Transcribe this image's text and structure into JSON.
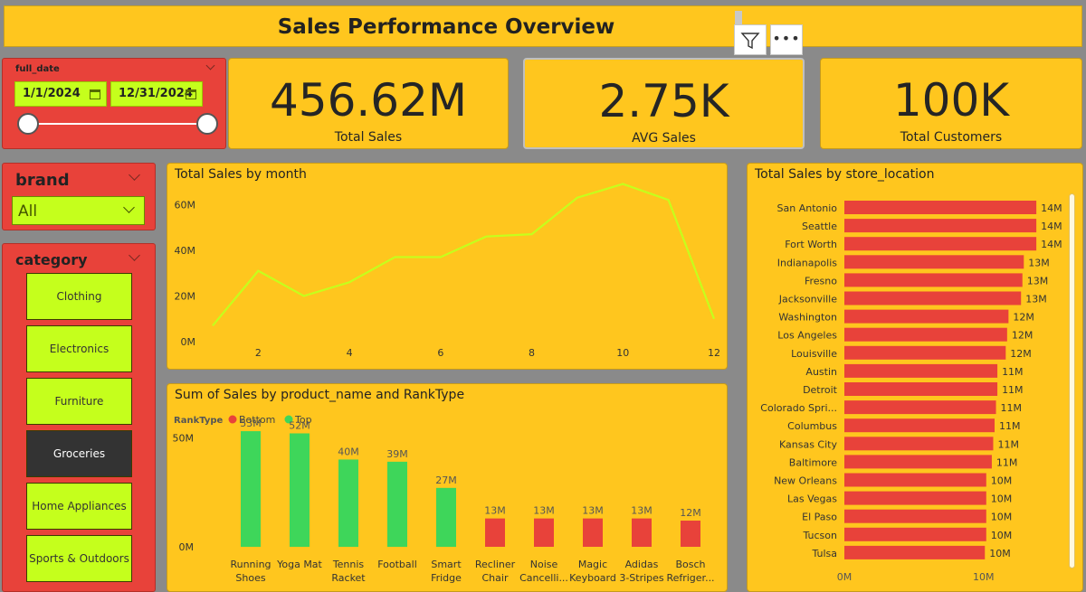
{
  "header": {
    "title": "Sales Performance Overview"
  },
  "date_slicer": {
    "label": "full_date",
    "start": "1/1/2024",
    "end": "12/31/2024"
  },
  "kpis": [
    {
      "value": "456.62M",
      "label": "Total Sales"
    },
    {
      "value": "2.75K",
      "label": "AVG Sales"
    },
    {
      "value": "100K",
      "label": "Total Customers"
    }
  ],
  "brand_slicer": {
    "label": "brand",
    "value": "All"
  },
  "category_slicer": {
    "label": "category",
    "items": [
      "Clothing",
      "Electronics",
      "Furniture",
      "Groceries",
      "Home Appliances",
      "Sports & Outdoors"
    ],
    "selected": "Groceries"
  },
  "colors": {
    "background": "#8a8a8a",
    "panel": "#ffc61e",
    "slicer": "#e8423a",
    "accent_lime": "#c5ff1c",
    "top_green": "#3ed65a",
    "bottom_red": "#e8423a",
    "line": "#c5ff1c"
  },
  "icons": {
    "filter": "filter-icon",
    "more": "more-options-icon",
    "calendar": "calendar-icon"
  },
  "chart_data": [
    {
      "type": "line",
      "title": "Total Sales by month",
      "x": [
        1,
        2,
        3,
        4,
        5,
        6,
        7,
        8,
        9,
        10,
        11,
        12
      ],
      "x_ticks": [
        "2",
        "4",
        "6",
        "8",
        "10",
        "12"
      ],
      "y_ticks": [
        "0M",
        "20M",
        "40M",
        "60M"
      ],
      "series": [
        {
          "values": [
            7,
            31,
            20,
            26,
            37,
            37,
            46,
            47,
            63,
            69,
            62,
            10
          ]
        }
      ],
      "ylim": [
        0,
        70
      ],
      "xlim": [
        1,
        12
      ],
      "grid": false
    },
    {
      "type": "bar",
      "title": "Sum of Sales by product_name and RankType",
      "legend_title": "RankType",
      "legend": [
        "Bottom",
        "Top"
      ],
      "categories": [
        "Running Shoes",
        "Yoga Mat",
        "Tennis Racket",
        "Football",
        "Smart Fridge",
        "Recliner Chair",
        "Noise Cancelli...",
        "Magic Keyboard",
        "Adidas 3-Stripes",
        "Bosch Refriger..."
      ],
      "category_lines": [
        [
          "Running",
          "Shoes"
        ],
        [
          "Yoga Mat"
        ],
        [
          "Tennis",
          "Racket"
        ],
        [
          "Football"
        ],
        [
          "Smart",
          "Fridge"
        ],
        [
          "Recliner",
          "Chair"
        ],
        [
          "Noise",
          "Cancelli..."
        ],
        [
          "Magic",
          "Keyboard"
        ],
        [
          "Adidas",
          "3-Stripes"
        ],
        [
          "Bosch",
          "Refriger..."
        ]
      ],
      "values": [
        53,
        52,
        40,
        39,
        27,
        13,
        13,
        13,
        13,
        12
      ],
      "data_labels": [
        "53M",
        "52M",
        "40M",
        "39M",
        "27M",
        "13M",
        "13M",
        "13M",
        "13M",
        "12M"
      ],
      "rank": [
        "Top",
        "Top",
        "Top",
        "Top",
        "Top",
        "Bottom",
        "Bottom",
        "Bottom",
        "Bottom",
        "Bottom"
      ],
      "y_ticks": [
        "0M",
        "50M"
      ],
      "ylim": [
        0,
        58
      ]
    },
    {
      "type": "bar",
      "orientation": "horizontal",
      "title": "Total Sales by store_location",
      "categories": [
        "San Antonio",
        "Seattle",
        "Fort Worth",
        "Indianapolis",
        "Fresno",
        "Jacksonville",
        "Washington",
        "Los Angeles",
        "Louisville",
        "Austin",
        "Detroit",
        "Colorado Spri...",
        "Columbus",
        "Kansas City",
        "Baltimore",
        "New Orleans",
        "Las Vegas",
        "El Paso",
        "Tucson",
        "Tulsa"
      ],
      "values": [
        13.8,
        13.8,
        13.8,
        12.9,
        12.8,
        12.7,
        11.8,
        11.7,
        11.6,
        11.0,
        11.0,
        10.9,
        10.8,
        10.7,
        10.6,
        10.2,
        10.2,
        10.2,
        10.2,
        10.1
      ],
      "data_labels": [
        "14M",
        "14M",
        "14M",
        "13M",
        "13M",
        "13M",
        "12M",
        "12M",
        "12M",
        "11M",
        "11M",
        "11M",
        "11M",
        "11M",
        "11M",
        "10M",
        "10M",
        "10M",
        "10M",
        "10M"
      ],
      "x_ticks": [
        "0M",
        "10M"
      ],
      "xlim": [
        0,
        16.2
      ]
    }
  ]
}
